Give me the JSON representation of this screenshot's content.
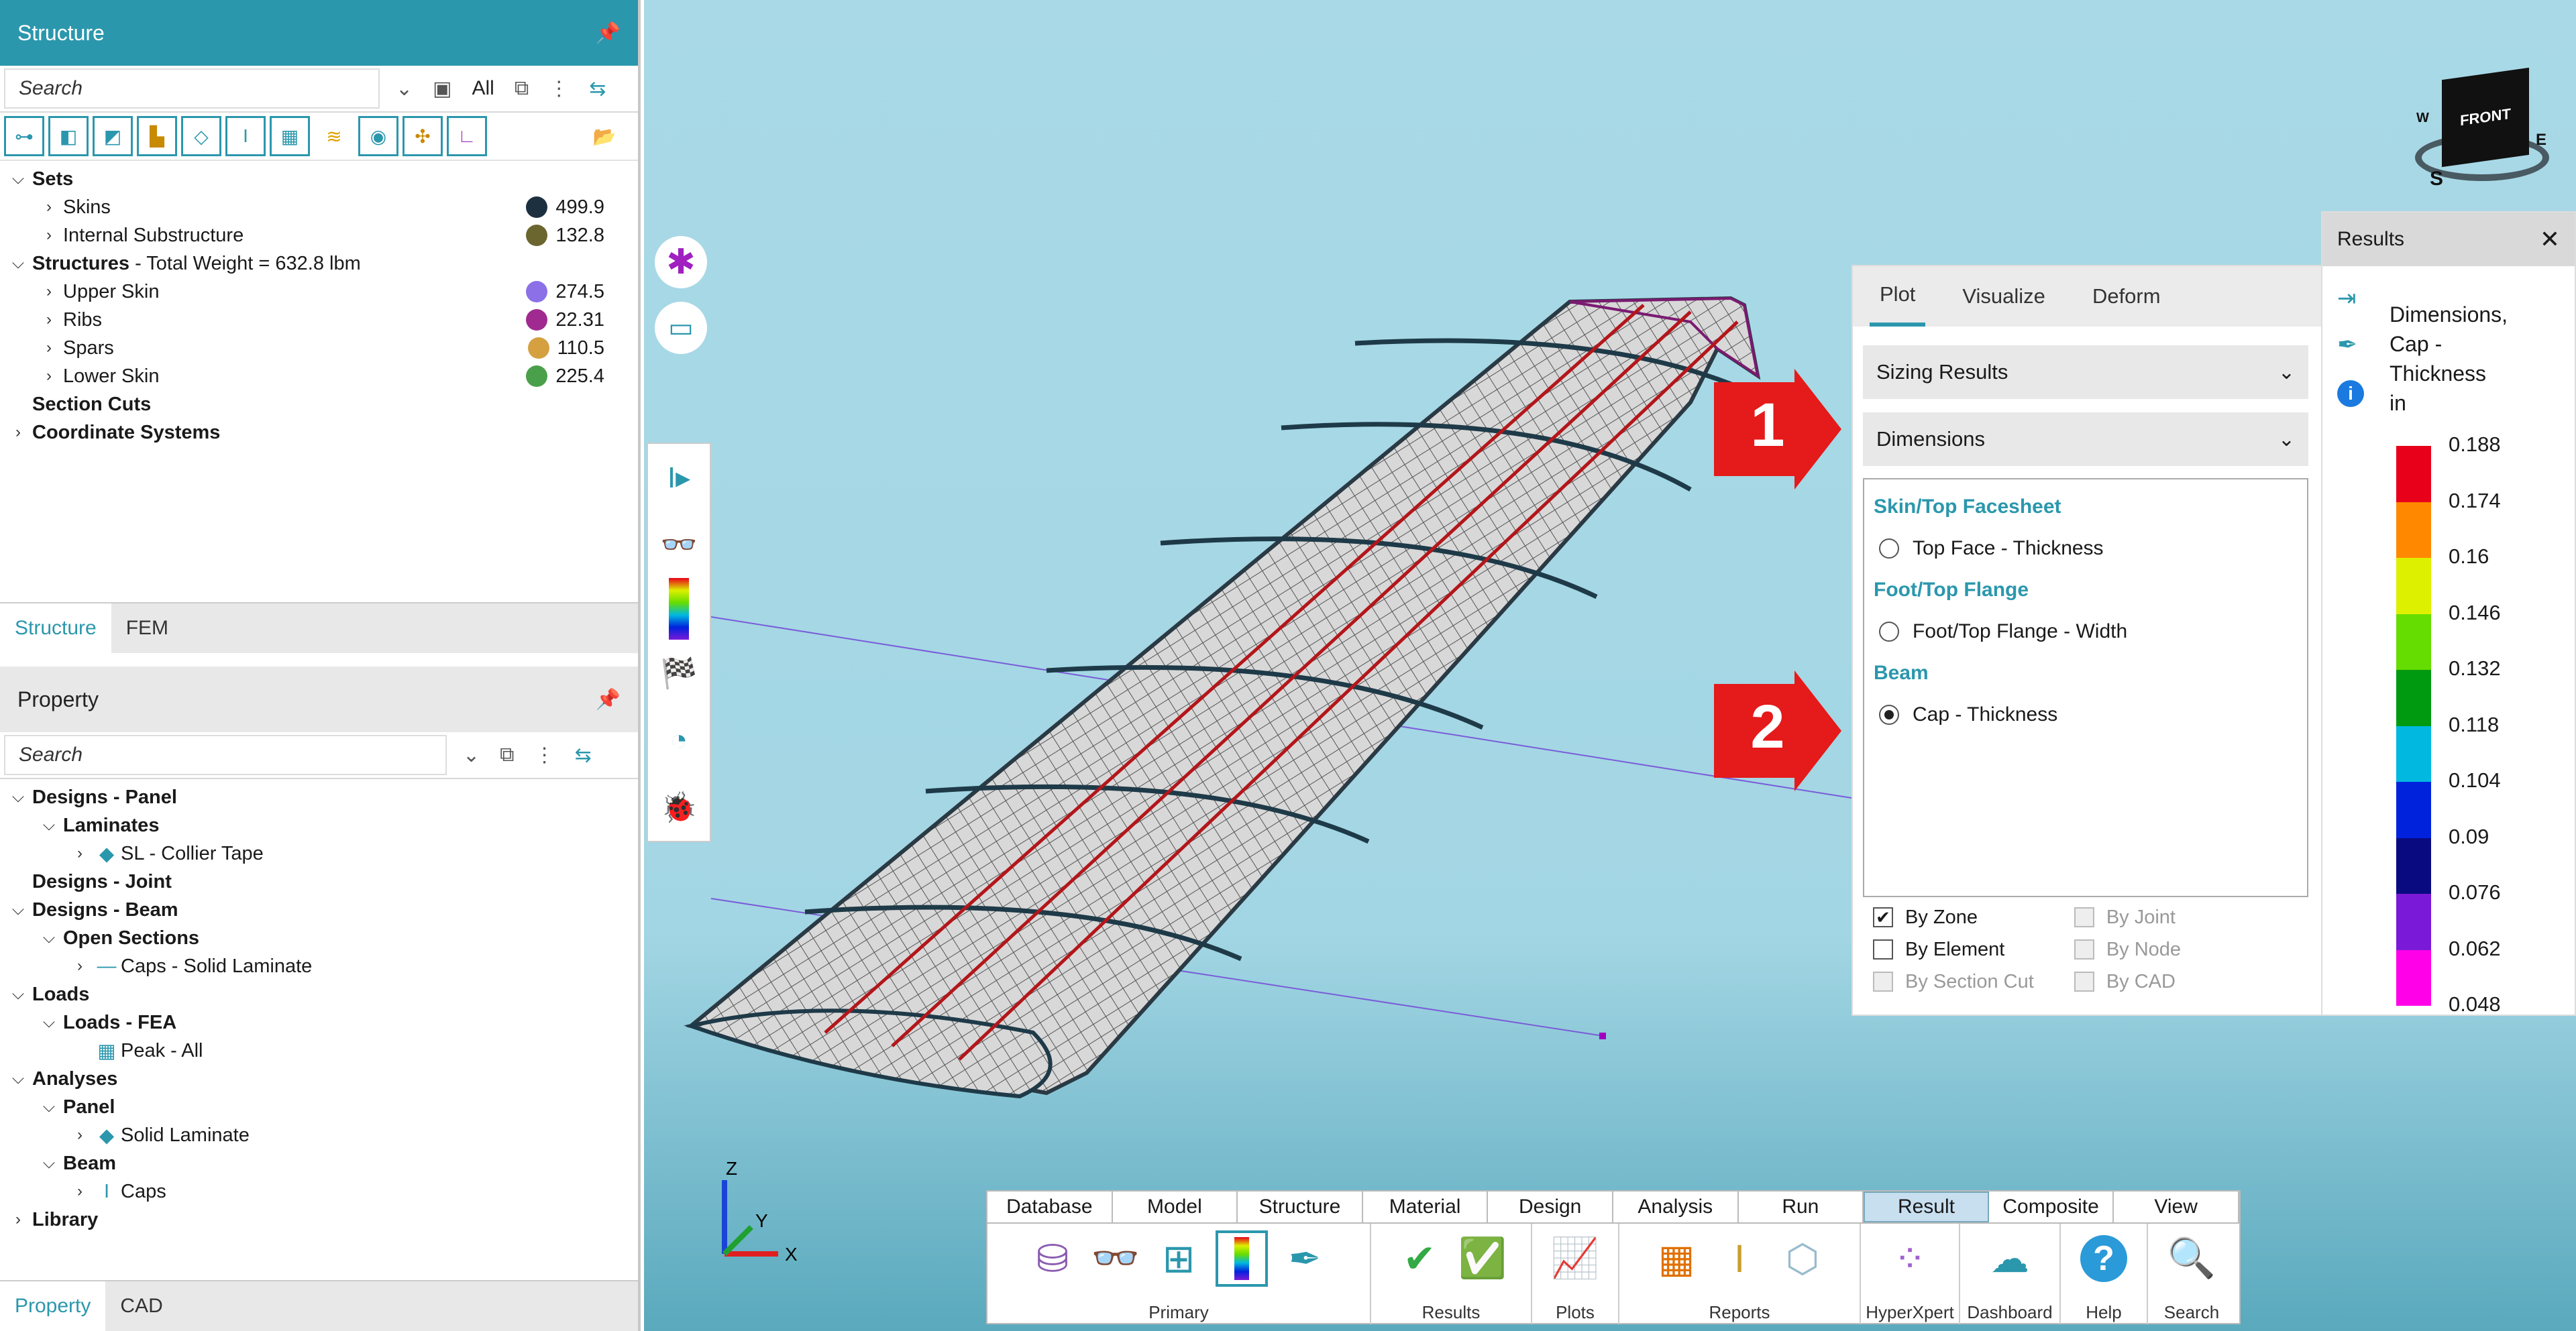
{
  "structure_panel": {
    "title": "Structure",
    "search_placeholder": "Search",
    "filter_value": "All",
    "tree": [
      {
        "label": "Sets",
        "bold": true,
        "level": 0,
        "expander": "v"
      },
      {
        "label": "Skins",
        "level": 1,
        "expander": ">",
        "value": "499.9",
        "color": "#1d3040"
      },
      {
        "label": "Internal Substructure",
        "level": 1,
        "expander": ">",
        "value": "132.8",
        "color": "#6b6530"
      },
      {
        "label": "Structures",
        "suffix": " - Total Weight = 632.8 lbm",
        "bold": true,
        "level": 0,
        "expander": "v"
      },
      {
        "label": "Upper Skin",
        "level": 1,
        "expander": ">",
        "value": "274.5",
        "color": "#8b70e8"
      },
      {
        "label": "Ribs",
        "level": 1,
        "expander": ">",
        "value": "22.31",
        "color": "#a02a90"
      },
      {
        "label": "Spars",
        "level": 1,
        "expander": ">",
        "value": "110.5",
        "color": "#d4a040"
      },
      {
        "label": "Lower Skin",
        "level": 1,
        "expander": ">",
        "value": "225.4",
        "color": "#4aa04a"
      },
      {
        "label": "Section Cuts",
        "bold": true,
        "level": 0,
        "expander": ""
      },
      {
        "label": "Coordinate Systems",
        "bold": true,
        "level": 0,
        "expander": ">"
      }
    ],
    "tabs": [
      "Structure",
      "FEM"
    ]
  },
  "property_panel": {
    "title": "Property",
    "search_placeholder": "Search",
    "tree": [
      {
        "label": "Designs - Panel",
        "bold": true,
        "level": 0,
        "expander": "v"
      },
      {
        "label": "Laminates",
        "bold": true,
        "level": 1,
        "expander": "v"
      },
      {
        "label": "SL - Collier Tape",
        "level": 2,
        "expander": ">",
        "icon": "◆"
      },
      {
        "label": "Designs - Joint",
        "bold": true,
        "level": 0,
        "expander": ""
      },
      {
        "label": "Designs - Beam",
        "bold": true,
        "level": 0,
        "expander": "v"
      },
      {
        "label": "Open Sections",
        "bold": true,
        "level": 1,
        "expander": "v"
      },
      {
        "label": "Caps - Solid Laminate",
        "level": 2,
        "expander": ">",
        "icon": "—"
      },
      {
        "label": "Loads",
        "bold": true,
        "level": 0,
        "expander": "v"
      },
      {
        "label": "Loads - FEA",
        "bold": true,
        "level": 1,
        "expander": "v"
      },
      {
        "label": "Peak - All",
        "level": 2,
        "expander": "",
        "icon": "▦"
      },
      {
        "label": "Analyses",
        "bold": true,
        "level": 0,
        "expander": "v"
      },
      {
        "label": "Panel",
        "bold": true,
        "level": 1,
        "expander": "v"
      },
      {
        "label": "Solid Laminate",
        "level": 2,
        "expander": ">",
        "icon": "◆"
      },
      {
        "label": "Beam",
        "bold": true,
        "level": 1,
        "expander": "v"
      },
      {
        "label": "Caps",
        "level": 2,
        "expander": ">",
        "icon": "I"
      },
      {
        "label": "Library",
        "bold": true,
        "level": 0,
        "expander": ">"
      }
    ],
    "tabs": [
      "Property",
      "CAD"
    ]
  },
  "results_panel": {
    "tabs": [
      "Plot",
      "Visualize",
      "Deform"
    ],
    "sizing_results": "Sizing Results",
    "dimensions": "Dimensions",
    "sections": [
      {
        "title": "Skin/Top Facesheet",
        "option": "Top Face - Thickness",
        "selected": false
      },
      {
        "title": "Foot/Top Flange",
        "option": "Foot/Top Flange - Width",
        "selected": false
      },
      {
        "title": "Beam",
        "option": "Cap - Thickness",
        "selected": true
      }
    ],
    "checks_left": [
      {
        "label": "By Zone",
        "checked": true,
        "disabled": false
      },
      {
        "label": "By Element",
        "checked": false,
        "disabled": false
      },
      {
        "label": "By Section Cut",
        "checked": false,
        "disabled": true
      }
    ],
    "checks_right": [
      {
        "label": "By Joint",
        "checked": false,
        "disabled": true
      },
      {
        "label": "By Node",
        "checked": false,
        "disabled": true
      },
      {
        "label": "By CAD",
        "checked": false,
        "disabled": true
      }
    ]
  },
  "legend": {
    "title": "Results",
    "name_line1": "Dimensions,",
    "name_line2": "Cap -",
    "name_line3": "Thickness",
    "unit": "in",
    "values": [
      "0.188",
      "0.174",
      "0.16",
      "0.146",
      "0.132",
      "0.118",
      "0.104",
      "0.09",
      "0.076",
      "0.062",
      "0.048"
    ],
    "colors": [
      "#e8001a",
      "#ff8800",
      "#ddf000",
      "#66dd00",
      "#009a10",
      "#00b8e0",
      "#0022dd",
      "#0a0a80",
      "#7a1ad8",
      "#ff00e8"
    ]
  },
  "callouts": [
    "1",
    "2"
  ],
  "view_cube": {
    "face": "FRONT",
    "compass_s": "S",
    "compass_e": "E",
    "compass_w": "W"
  },
  "axes": {
    "z": "Z",
    "y": "Y",
    "x": "X"
  },
  "ribbon": {
    "tabs": [
      "Database",
      "Model",
      "Structure",
      "Material",
      "Design",
      "Analysis",
      "Run",
      "Result",
      "Composite",
      "View"
    ],
    "active_tab": "Result",
    "groups": [
      "Primary",
      "Results",
      "Plots",
      "Reports",
      "HyperXpert",
      "Dashboard",
      "Help",
      "Search"
    ]
  }
}
